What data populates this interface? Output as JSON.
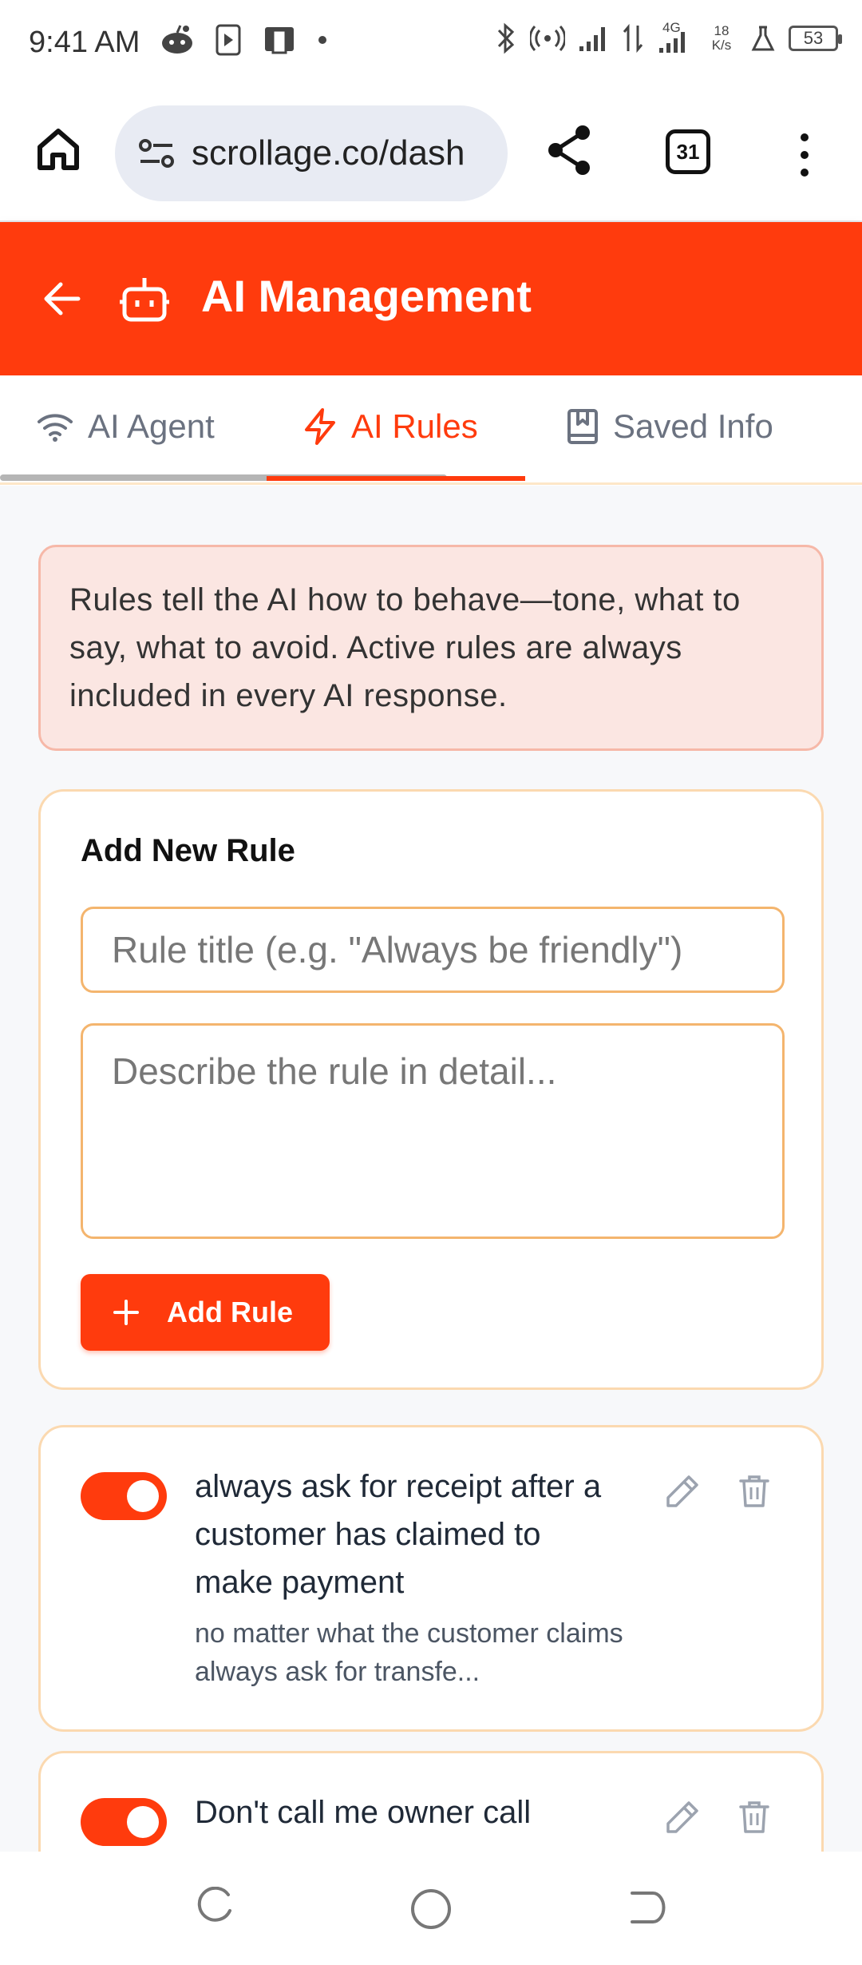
{
  "status_bar": {
    "time": "9:41 AM",
    "network_type": "4G",
    "speed_value": "18",
    "speed_unit": "K/s",
    "battery": "53"
  },
  "browser": {
    "url": "scrollage.co/dash",
    "tab_count": "31"
  },
  "header": {
    "title": "AI Management"
  },
  "tabs": [
    {
      "label": "AI Agent",
      "icon": "wifi-icon",
      "active": false
    },
    {
      "label": "AI Rules",
      "icon": "lightning-icon",
      "active": true
    },
    {
      "label": "Saved Info",
      "icon": "bookmark-book-icon",
      "active": false
    }
  ],
  "info": {
    "text": "Rules tell the AI how to behave—tone, what to say, what to avoid. Active rules are always included in every AI response."
  },
  "add_rule": {
    "heading": "Add New Rule",
    "title_placeholder": "Rule title (e.g. \"Always be friendly\")",
    "title_value": "",
    "desc_placeholder": "Describe the rule in detail...",
    "desc_value": "",
    "button_label": "Add Rule"
  },
  "rules": [
    {
      "title": "always ask for receipt after a customer has claimed to make payment",
      "description": "no matter what the customer claims always ask for transfe...",
      "enabled": true
    },
    {
      "title": "Don't call me owner call",
      "description": "",
      "enabled": true
    }
  ],
  "colors": {
    "accent": "#ff3b0d",
    "info_bg": "#fbe6e2",
    "card_border": "#fbd9b0"
  }
}
